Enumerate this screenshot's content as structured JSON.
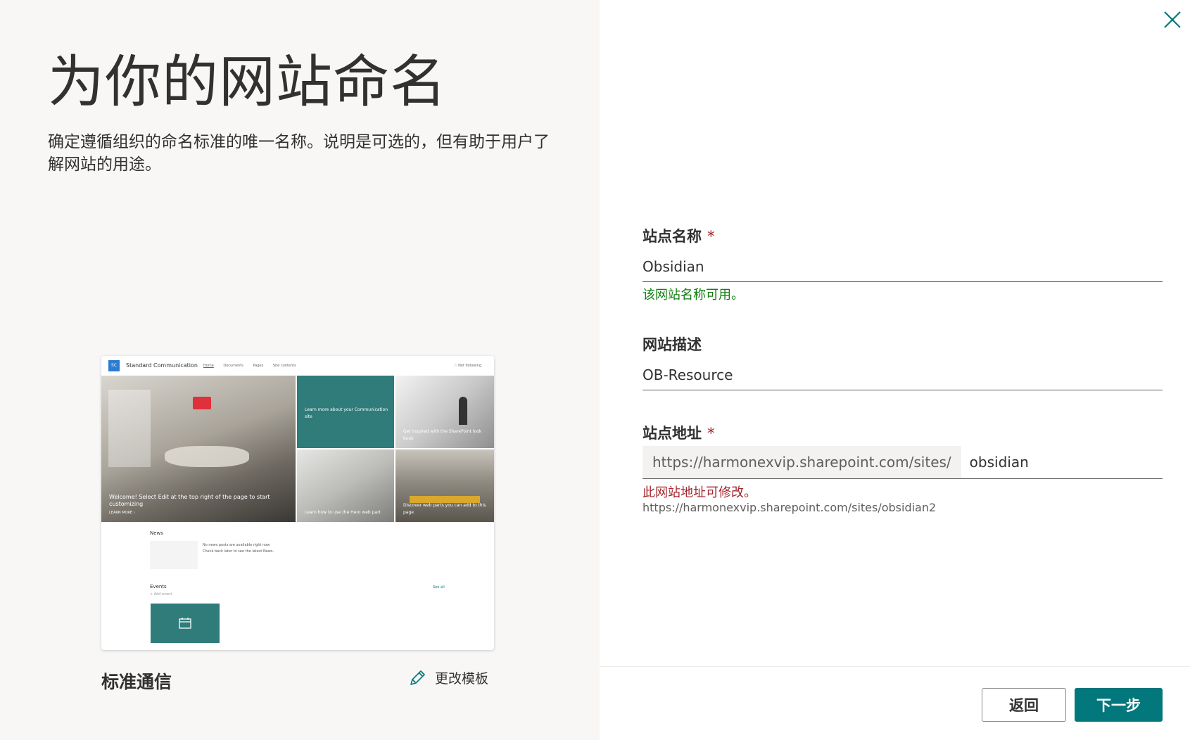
{
  "left": {
    "title": "为你的网站命名",
    "description": "确定遵循组织的命名标准的唯一名称。说明是可选的，但有助于用户了解网站的用途。",
    "template_name": "标准通信",
    "change_template_label": "更改模板"
  },
  "preview": {
    "logo_text": "SC",
    "site_name": "Standard Communication",
    "nav": [
      "Home",
      "Documents",
      "Pages",
      "Site contents"
    ],
    "follow": "☆ Not following",
    "hero_main_caption": "Welcome! Select Edit at the top right of the page to start customizing",
    "hero_main_link": "LEARN MORE ›",
    "tile_learn": "Learn more about your Communication site",
    "tile_inspired": "Get inspired with the SharePoint look book",
    "tile_hero": "Learn how to use the Hero web part",
    "tile_discover": "Discover web parts you can add to this page",
    "news_label": "News",
    "news_empty": "No news posts are available right now",
    "news_hint": "Check back later to see the latest News.",
    "events_label": "Events",
    "events_see_all": "See all",
    "events_add": "+ Add event"
  },
  "form": {
    "site_name_label": "站点名称",
    "site_name_value": "Obsidian",
    "site_name_ok": "该网站名称可用。",
    "desc_label": "网站描述",
    "desc_value": "OB-Resource",
    "address_label": "站点地址",
    "address_prefix": "https://harmonexvip.sharepoint.com/sites/",
    "address_value": "obsidian",
    "address_warn": "此网站地址可修改。",
    "address_hint": "https://harmonexvip.sharepoint.com/sites/obsidian2",
    "required_mark": "*"
  },
  "footer": {
    "back_label": "返回",
    "next_label": "下一步"
  },
  "colors": {
    "accent": "#03787c",
    "success": "#107c10",
    "error": "#a4262c"
  },
  "icons": {
    "close": "close-icon",
    "edit": "pencil-icon",
    "calendar": "calendar-icon"
  }
}
